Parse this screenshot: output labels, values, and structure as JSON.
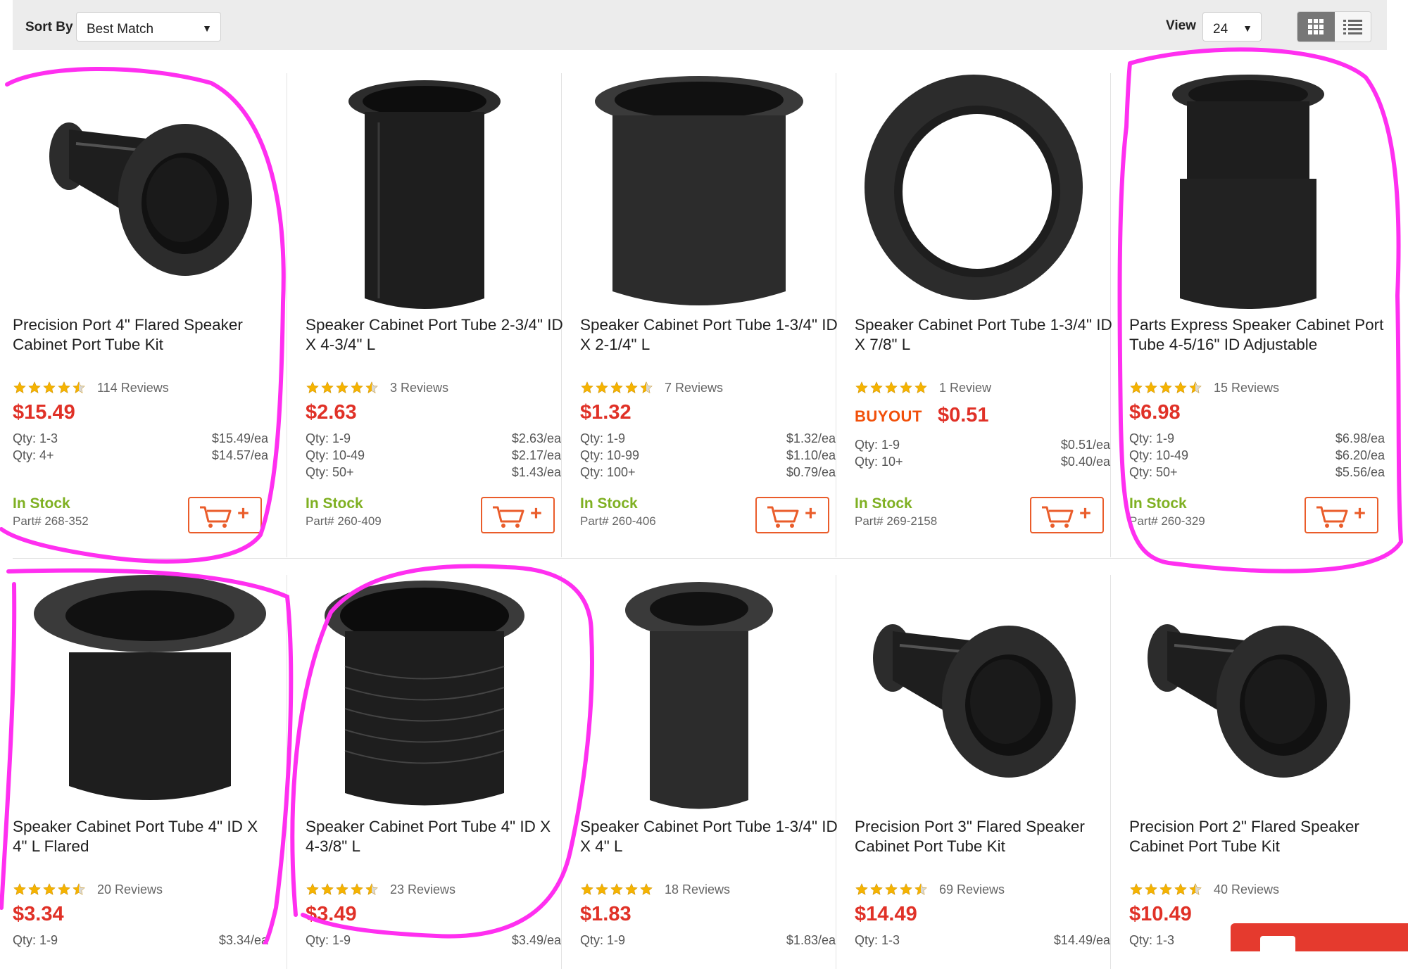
{
  "toolbar": {
    "sort_label": "Sort By",
    "sort_value": "Best Match",
    "view_label": "View",
    "view_value": "24",
    "view_modes": [
      "grid-icon",
      "list-icon"
    ]
  },
  "colors": {
    "price": "#e03127",
    "in_stock": "#7fb022",
    "cart_accent": "#ea5c2a",
    "annotation": "#ff2ff0",
    "star": "#f5b301"
  },
  "products": [
    {
      "title": "Precision Port 4\" Flared Speaker Cabinet Port Tube Kit",
      "rating": 4.5,
      "reviews": "114 Reviews",
      "price": "$15.49",
      "tiers": [
        [
          "Qty: 1-3",
          "$15.49/ea"
        ],
        [
          "Qty: 4+",
          "$14.57/ea"
        ]
      ],
      "stock": "In Stock",
      "part": "Part# 268-352",
      "image": "flared-port-large"
    },
    {
      "title": "Speaker Cabinet Port Tube 2-3/4\" ID X 4-3/4\" L",
      "rating": 4.5,
      "reviews": "3 Reviews",
      "price": "$2.63",
      "tiers": [
        [
          "Qty: 1-9",
          "$2.63/ea"
        ],
        [
          "Qty: 10-49",
          "$2.17/ea"
        ],
        [
          "Qty: 50+",
          "$1.43/ea"
        ]
      ],
      "stock": "In Stock",
      "part": "Part# 260-409",
      "image": "tall-tube"
    },
    {
      "title": "Speaker Cabinet Port Tube 1-3/4\" ID X 2-1/4\" L",
      "rating": 4.5,
      "reviews": "7 Reviews",
      "price": "$1.32",
      "tiers": [
        [
          "Qty: 1-9",
          "$1.32/ea"
        ],
        [
          "Qty: 10-99",
          "$1.10/ea"
        ],
        [
          "Qty: 100+",
          "$0.79/ea"
        ]
      ],
      "stock": "In Stock",
      "part": "Part# 260-406",
      "image": "wide-tube"
    },
    {
      "title": "Speaker Cabinet Port Tube 1-3/4\" ID X 7/8\" L",
      "rating": 5,
      "reviews": "1 Review",
      "buyout": "BUYOUT",
      "price": "$0.51",
      "tiers": [
        [
          "Qty: 1-9",
          "$0.51/ea"
        ],
        [
          "Qty: 10+",
          "$0.40/ea"
        ]
      ],
      "stock": "In Stock",
      "part": "Part# 269-2158",
      "image": "ring"
    },
    {
      "title": "Parts Express Speaker Cabinet Port Tube 4-5/16\" ID Adjustable",
      "rating": 4.5,
      "reviews": "15 Reviews",
      "price": "$6.98",
      "tiers": [
        [
          "Qty: 1-9",
          "$6.98/ea"
        ],
        [
          "Qty: 10-49",
          "$6.20/ea"
        ],
        [
          "Qty: 50+",
          "$5.56/ea"
        ]
      ],
      "stock": "In Stock",
      "part": "Part# 260-329",
      "image": "adjustable-tube"
    },
    {
      "title": "Speaker Cabinet Port Tube 4\" ID X 4\" L Flared",
      "rating": 4.5,
      "reviews": "20 Reviews",
      "price": "$3.34",
      "tiers": [
        [
          "Qty: 1-9",
          "$3.34/ea"
        ]
      ],
      "image": "short-flared"
    },
    {
      "title": "Speaker Cabinet Port Tube 4\" ID X 4-3/8\" L",
      "rating": 4.5,
      "reviews": "23 Reviews",
      "price": "$3.49",
      "tiers": [
        [
          "Qty: 1-9",
          "$3.49/ea"
        ]
      ],
      "image": "ribbed-tube"
    },
    {
      "title": "Speaker Cabinet Port Tube 1-3/4\" ID X 4\" L",
      "rating": 5,
      "reviews": "18 Reviews",
      "price": "$1.83",
      "tiers": [
        [
          "Qty: 1-9",
          "$1.83/ea"
        ]
      ],
      "image": "narrow-tube"
    },
    {
      "title": "Precision Port 3\" Flared Speaker Cabinet Port Tube Kit",
      "rating": 4.5,
      "reviews": "69 Reviews",
      "price": "$14.49",
      "tiers": [
        [
          "Qty: 1-3",
          "$14.49/ea"
        ]
      ],
      "image": "flared-port-medium"
    },
    {
      "title": "Precision Port 2\" Flared Speaker Cabinet Port Tube Kit",
      "rating": 4.5,
      "reviews": "40 Reviews",
      "price": "$10.49",
      "tiers": [
        [
          "Qty: 1-3",
          ""
        ]
      ],
      "image": "flared-port-small"
    }
  ]
}
